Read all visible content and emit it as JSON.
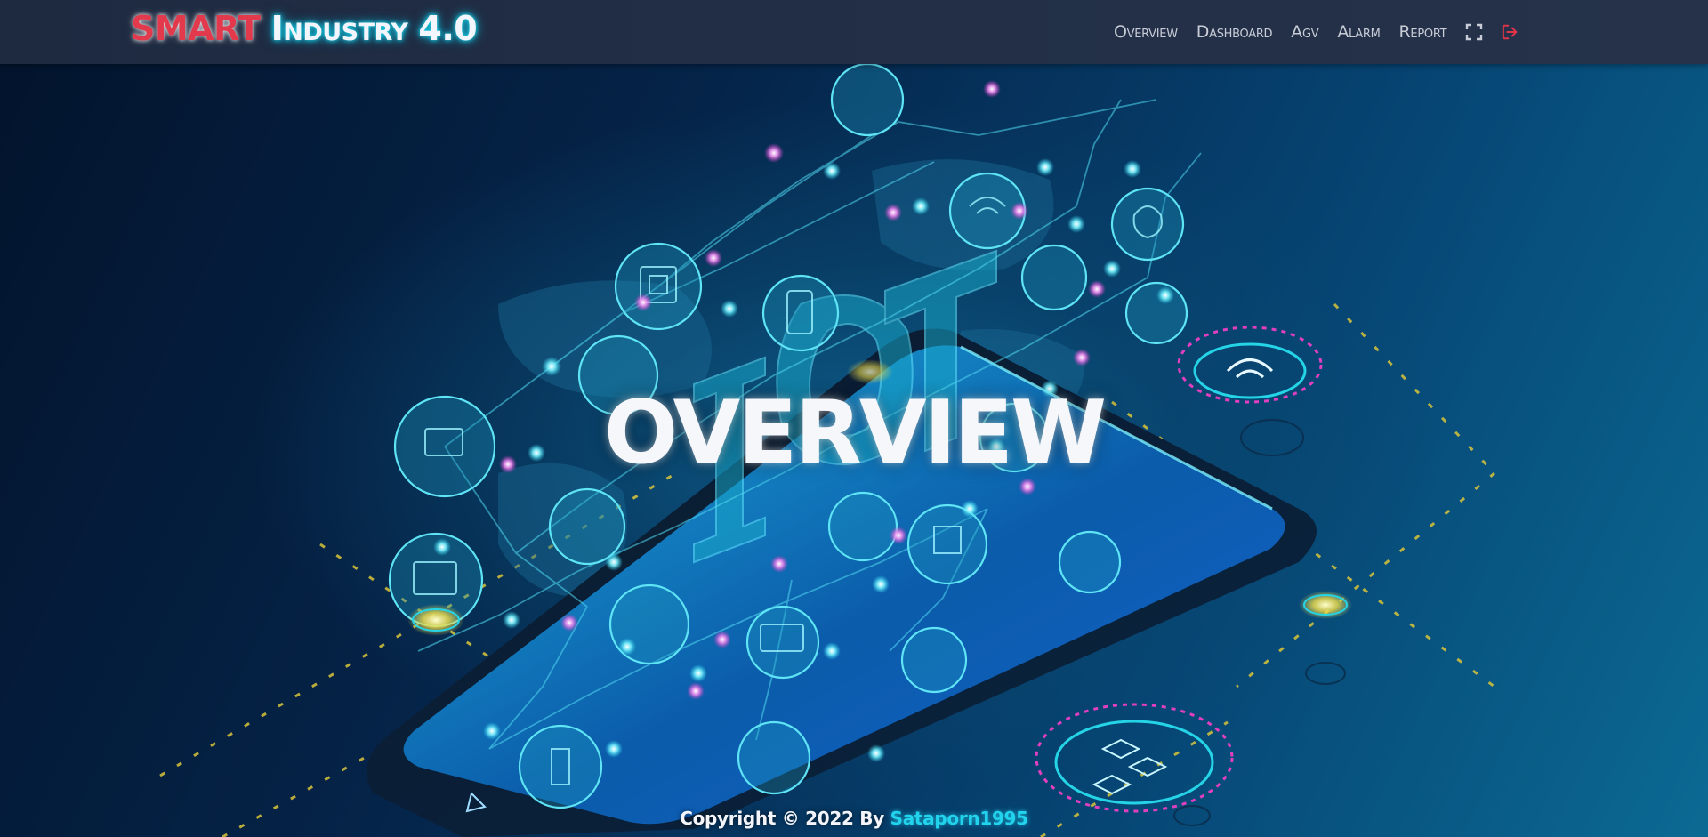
{
  "brand": {
    "smart": "SMART",
    "industry": "Industry",
    "version": "4.0"
  },
  "nav": {
    "items": [
      {
        "label": "Overview"
      },
      {
        "label": "Dashboard"
      },
      {
        "label": "Agv"
      },
      {
        "label": "Alarm"
      },
      {
        "label": "Report"
      }
    ],
    "icons": [
      "fullscreen-icon",
      "logout-icon"
    ]
  },
  "hero": {
    "title": "OVERVIEW",
    "background_letters": "IOT"
  },
  "footer": {
    "copyright": "Copyright © 2022 By",
    "author": "Sataporn1995"
  },
  "colors": {
    "brand_red": "#e23a4c",
    "neon_cyan": "#22d3ee",
    "nav_bg": "#222f47",
    "logout_red": "#e0344a",
    "magenta": "#e040c0",
    "yellow_glow": "#e8d84a"
  }
}
